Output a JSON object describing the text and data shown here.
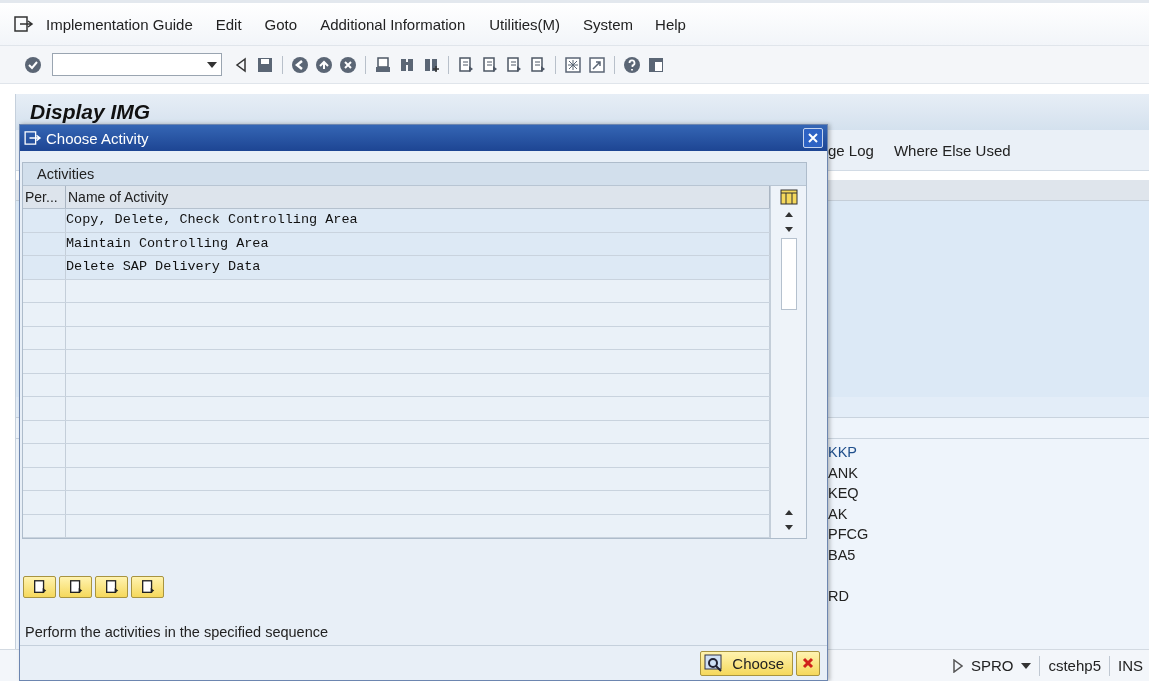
{
  "menu": [
    {
      "label": "Implementation Guide"
    },
    {
      "label": "Edit"
    },
    {
      "label": "Goto"
    },
    {
      "label": "Additional Information"
    },
    {
      "label": "Utilities(M)"
    },
    {
      "label": "System"
    },
    {
      "label": "Help"
    }
  ],
  "screen": {
    "title": "Display IMG",
    "app_toolbar": [
      "ge Log",
      "Where Else Used"
    ],
    "codes": [
      {
        "label": "KKP",
        "link": true,
        "gap_before": false
      },
      {
        "label": "ANK",
        "link": false,
        "gap_before": false
      },
      {
        "label": "KEQ",
        "link": false,
        "gap_before": false
      },
      {
        "label": "AK",
        "link": false,
        "gap_before": false
      },
      {
        "label": "PFCG",
        "link": false,
        "gap_before": false
      },
      {
        "label": "BA5",
        "link": false,
        "gap_before": false
      },
      {
        "label": "RD",
        "link": false,
        "gap_before": true
      }
    ]
  },
  "dialog": {
    "title": "Choose Activity",
    "section": "Activities",
    "columns": [
      "Per...",
      "Name of Activity"
    ],
    "rows": [
      {
        "name": "Copy, Delete, Check Controlling Area"
      },
      {
        "name": "Maintain Controlling Area"
      },
      {
        "name": "Delete SAP Delivery Data"
      }
    ],
    "message": "Perform the activities in the specified sequence",
    "buttons": [
      {
        "label": "Choose"
      }
    ]
  },
  "status_bar": {
    "transaction": "SPRO",
    "system": "cstehp5",
    "mode": "INS"
  }
}
